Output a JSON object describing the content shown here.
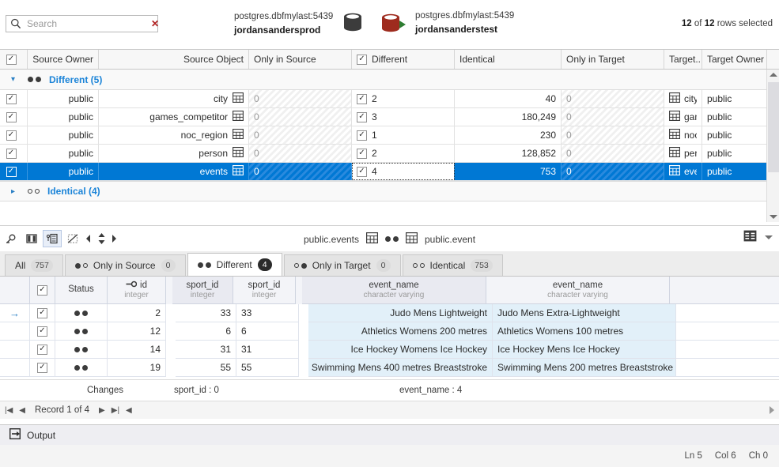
{
  "search": {
    "placeholder": "Search",
    "value": "",
    "clear_label": "✕"
  },
  "source_db": {
    "connection": "postgres.dbfmylast:5439",
    "name": "jordansandersprod",
    "color": "#3c3c3c"
  },
  "target_db": {
    "connection": "postgres.dbfmylast:5439",
    "name": "jordansanderstest",
    "color": "#9e2b1e"
  },
  "header": {
    "rows_selected_count": "12",
    "rows_selected_total": "12",
    "rows_selected_of": "of",
    "rows_selected_suffix": "rows selected"
  },
  "top_grid": {
    "columns": [
      {
        "label": "Source Owner",
        "align": "right"
      },
      {
        "label": "Source Object",
        "align": "right"
      },
      {
        "label": "Only in Source",
        "align": "left"
      },
      {
        "label": "Different",
        "align": "left",
        "checkbox": true
      },
      {
        "label": "Identical",
        "align": "left"
      },
      {
        "label": "Only in Target",
        "align": "left"
      },
      {
        "label": "Target...",
        "align": "left"
      },
      {
        "label": "Target Owner",
        "align": "left"
      }
    ],
    "groups": [
      {
        "label": "Different (5)",
        "expanded": true,
        "dots": "full-full"
      },
      {
        "label": "Identical (4)",
        "expanded": false,
        "dots": "open-open"
      }
    ],
    "rows": [
      {
        "checked": true,
        "source_owner": "public",
        "source_object": "city",
        "only_in_source": "0",
        "different": "2",
        "identical": "40",
        "only_in_target": "0",
        "target_object": "city",
        "target_owner": "public",
        "selected": false
      },
      {
        "checked": true,
        "source_owner": "public",
        "source_object": "games_competitor",
        "only_in_source": "0",
        "different": "3",
        "identical": "180,249",
        "only_in_target": "0",
        "target_object": "gam...",
        "target_owner": "public",
        "selected": false
      },
      {
        "checked": true,
        "source_owner": "public",
        "source_object": "noc_region",
        "only_in_source": "0",
        "different": "1",
        "identical": "230",
        "only_in_target": "0",
        "target_object": "noc...",
        "target_owner": "public",
        "selected": false
      },
      {
        "checked": true,
        "source_owner": "public",
        "source_object": "person",
        "only_in_source": "0",
        "different": "2",
        "identical": "128,852",
        "only_in_target": "0",
        "target_object": "pers...",
        "target_owner": "public",
        "selected": false
      },
      {
        "checked": true,
        "source_owner": "public",
        "source_object": "events",
        "only_in_source": "0",
        "different": "4",
        "identical": "753",
        "only_in_target": "0",
        "target_object": "event",
        "target_owner": "public",
        "selected": true
      }
    ]
  },
  "mid_toolbar": {
    "source_object_label": "public.events",
    "target_object_label": "public.event"
  },
  "tabs": [
    {
      "label": "All",
      "badge": "757",
      "dots": "none",
      "active": false
    },
    {
      "label": "Only in Source",
      "badge": "0",
      "dots": "full-open",
      "active": false
    },
    {
      "label": "Different",
      "badge": "4",
      "dots": "full-full",
      "active": true
    },
    {
      "label": "Only in Target",
      "badge": "0",
      "dots": "open-full",
      "active": false
    },
    {
      "label": "Identical",
      "badge": "753",
      "dots": "open-open",
      "active": false
    }
  ],
  "detail_grid": {
    "columns": [
      {
        "name": "",
        "type": ""
      },
      {
        "name": "",
        "type": "",
        "checkbox": true
      },
      {
        "name": "Status",
        "type": ""
      },
      {
        "name": "id",
        "type": "integer",
        "key": true
      },
      {
        "name": "sport_id",
        "type": "integer",
        "source": true
      },
      {
        "name": "sport_id",
        "type": "integer",
        "source": false
      },
      {
        "name": "event_name",
        "type": "character varying",
        "source": true
      },
      {
        "name": "event_name",
        "type": "character varying",
        "source": false
      }
    ],
    "rows": [
      {
        "current": true,
        "checked": true,
        "id": "2",
        "sport_id_src": "33",
        "sport_id_tgt": "33",
        "event_name_src": "Judo Mens Lightweight",
        "event_name_tgt": "Judo Mens Extra-Lightweight"
      },
      {
        "current": false,
        "checked": true,
        "id": "12",
        "sport_id_src": "6",
        "sport_id_tgt": "6",
        "event_name_src": "Athletics Womens 200 metres",
        "event_name_tgt": "Athletics Womens 100 metres"
      },
      {
        "current": false,
        "checked": true,
        "id": "14",
        "sport_id_src": "31",
        "sport_id_tgt": "31",
        "event_name_src": "Ice Hockey Womens Ice Hockey",
        "event_name_tgt": "Ice Hockey Mens Ice Hockey"
      },
      {
        "current": false,
        "checked": true,
        "id": "19",
        "sport_id_src": "55",
        "sport_id_tgt": "55",
        "event_name_src": "Swimming Mens 400 metres Breaststroke",
        "event_name_tgt": "Swimming Mens 200 metres Breaststroke"
      }
    ]
  },
  "changes_bar": {
    "label": "Changes",
    "sport_id": "sport_id : 0",
    "event_name": "event_name : 4"
  },
  "record_nav": {
    "text": "Record 1 of 4",
    "first": "|◀",
    "prev": "◀",
    "next": "▶",
    "last": "▶|"
  },
  "output_panel": {
    "label": "Output"
  },
  "status_bar": {
    "line": "Ln 5",
    "col": "Col 6",
    "ch": "Ch 0"
  },
  "colors": {
    "selection_blue": "#0078d4",
    "link_blue": "#1b84d8",
    "diff_cell": "#e2f0f9",
    "green_arrow": "#2e7d32",
    "target_red": "#9e2b1e"
  }
}
